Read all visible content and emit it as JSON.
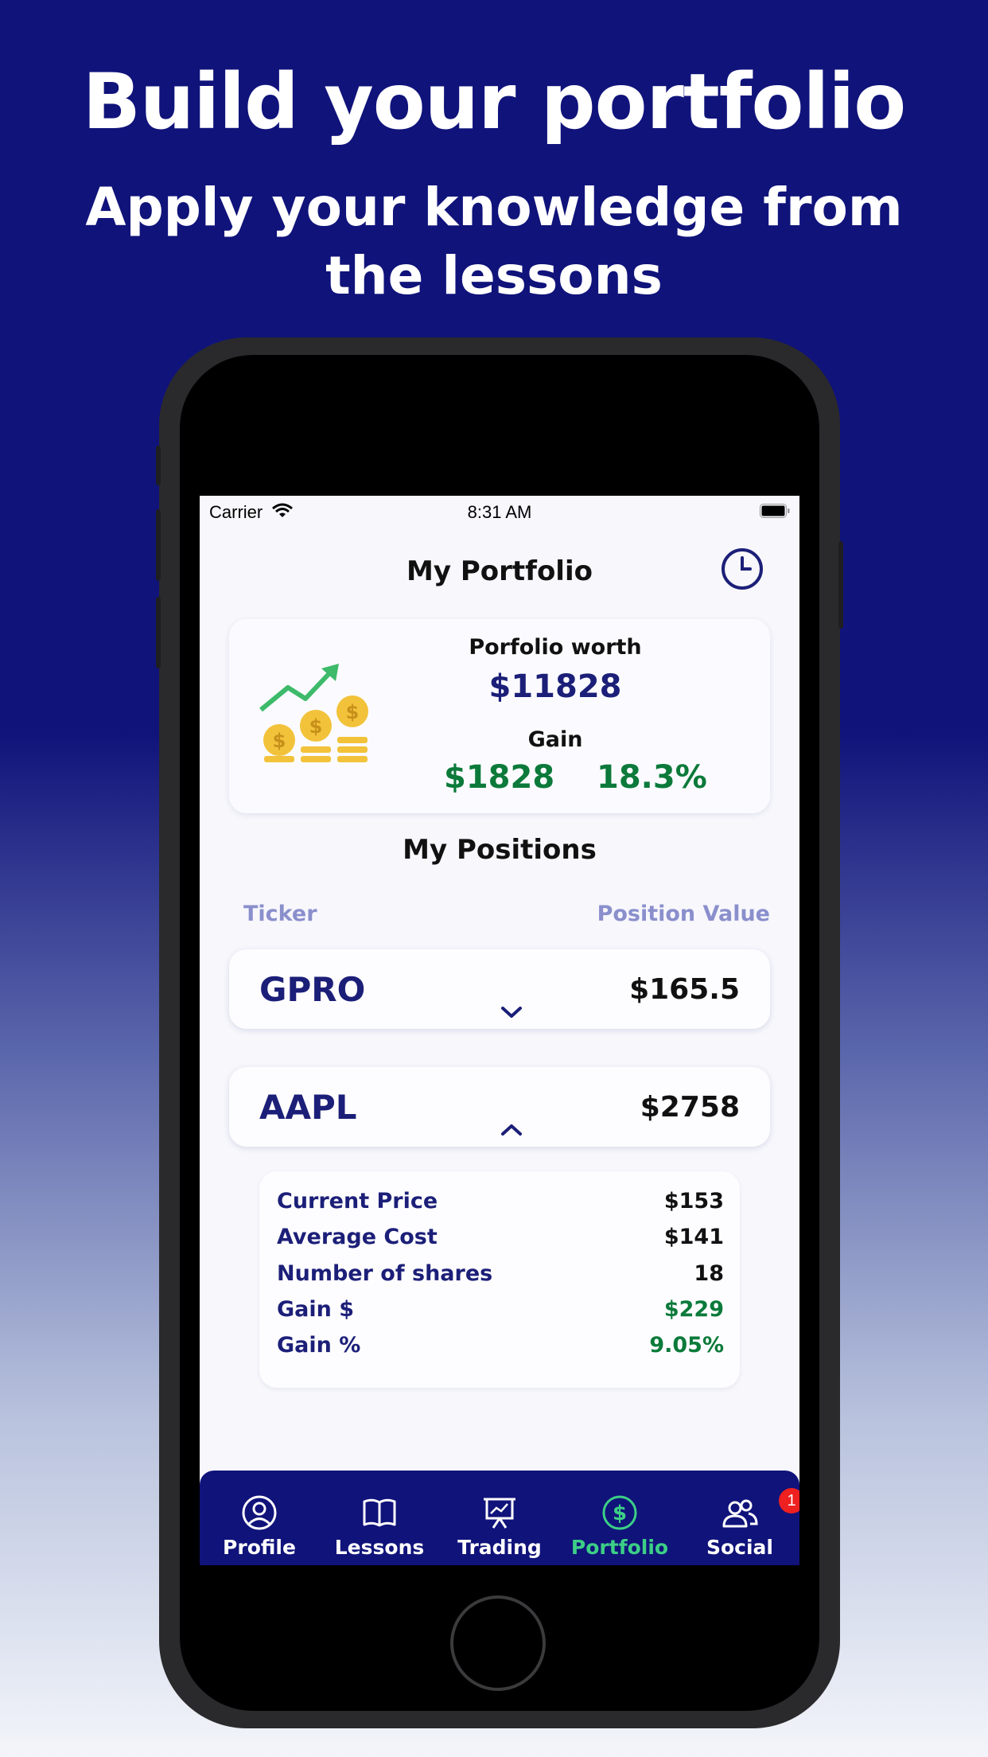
{
  "promo": {
    "headline": "Build your portfolio",
    "subline": "Apply your knowledge from the lessons"
  },
  "status_bar": {
    "carrier": "Carrier",
    "time": "8:31 AM"
  },
  "header": {
    "title": "My Portfolio",
    "history_icon": "clock-icon"
  },
  "summary": {
    "worth_label": "Porfolio worth",
    "worth_value": "$11828",
    "gain_label": "Gain",
    "gain_value": "$1828",
    "gain_percent": "18.3%",
    "icon": "growth-coins-icon"
  },
  "positions": {
    "title": "My Positions",
    "col_ticker": "Ticker",
    "col_value": "Position Value",
    "items": [
      {
        "ticker": "GPRO",
        "value": "$165.5",
        "expanded": false
      },
      {
        "ticker": "AAPL",
        "value": "$2758",
        "expanded": true
      }
    ],
    "details": {
      "rows": [
        {
          "label": "Current Price",
          "value": "$153"
        },
        {
          "label": "Average Cost",
          "value": "$141"
        },
        {
          "label": "Number of shares",
          "value": "18"
        },
        {
          "label": "Gain $",
          "value": "$229"
        },
        {
          "label": "Gain %",
          "value": "9.05%"
        }
      ]
    }
  },
  "tabbar": {
    "tabs": [
      {
        "label": "Profile",
        "icon": "user-circle-icon"
      },
      {
        "label": "Lessons",
        "icon": "book-icon"
      },
      {
        "label": "Trading",
        "icon": "presentation-chart-icon"
      },
      {
        "label": "Portfolio",
        "icon": "dollar-circle-icon",
        "active": true
      },
      {
        "label": "Social",
        "icon": "users-icon",
        "badge": "1"
      }
    ]
  },
  "colors": {
    "brand_navy": "#10137a",
    "gain_green": "#0b7a3a",
    "active_tab_green": "#3ccf86",
    "ticker_navy": "#1c1f78",
    "column_header": "#8a8fcc"
  }
}
